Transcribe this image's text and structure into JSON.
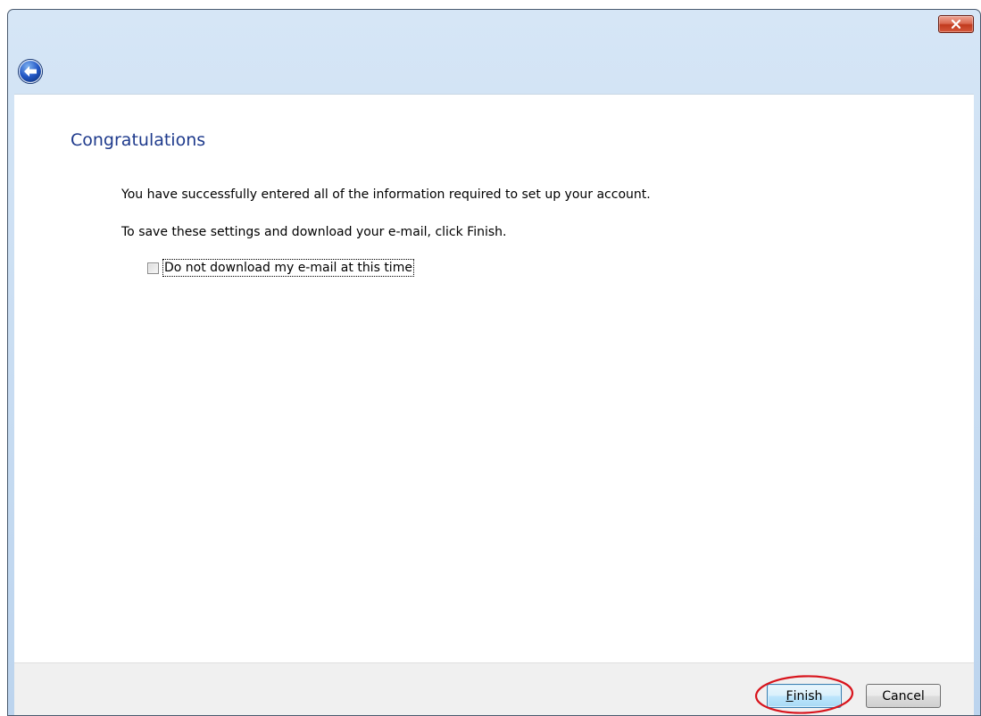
{
  "window": {
    "close_icon": "close-x-icon",
    "back_icon": "back-arrow-icon",
    "accent_color": "#1e3a8c",
    "close_color": "#c13a1e"
  },
  "content": {
    "title": "Congratulations",
    "line1": "You have successfully entered all of the information required to set up your account.",
    "line2": "To save these settings and download your e-mail, click Finish.",
    "checkbox": {
      "label": "Do not download my e-mail at this time",
      "checked": false
    }
  },
  "footer": {
    "finish_mnemonic": "F",
    "finish_rest": "inish",
    "cancel_label": "Cancel",
    "highlight_color": "#d8141c"
  }
}
